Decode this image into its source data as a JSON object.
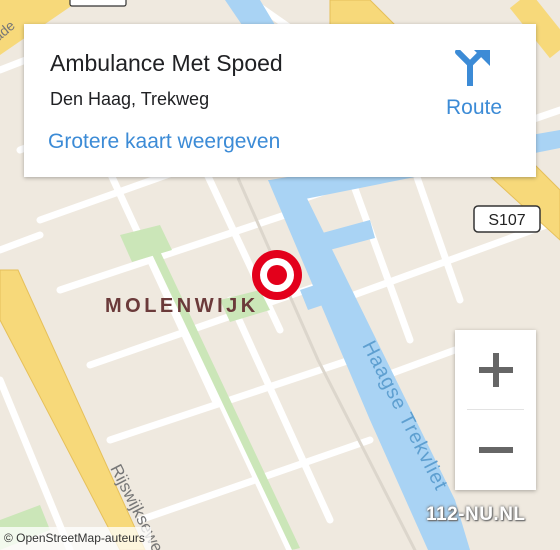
{
  "card": {
    "title": "Ambulance Met Spoed",
    "address": "Den Haag, Trekweg",
    "bigger_map_link": "Grotere kaart weergeven",
    "route_label": "Route",
    "route_icon": "turn-right-arrow-icon"
  },
  "map": {
    "neighborhood_label": "MOLENWIJK",
    "road_shield": "S107",
    "canal_label": "Haagse Trekvliet",
    "street_label_bottom": "Rijswijkseweg",
    "street_label_topleft": "ade",
    "marker_icon": "location-target-icon",
    "colors": {
      "water": "#a9d3f4",
      "land": "#efe9df",
      "street": "#ffffff",
      "main_road": "#f7d97a",
      "green": "#cbe6b8",
      "marker": "#e3001b"
    }
  },
  "zoom": {
    "in_icon": "plus-icon",
    "out_icon": "minus-icon"
  },
  "attribution": "© OpenStreetMap-auteurs",
  "watermark": "112-NU.NL"
}
